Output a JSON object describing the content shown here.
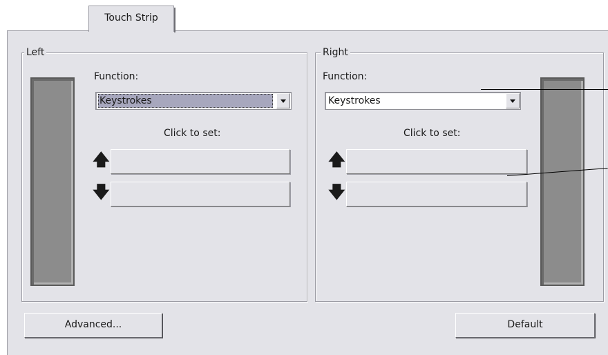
{
  "tab": {
    "label": "Touch Strip"
  },
  "left": {
    "group_label": "Left",
    "function_label": "Function:",
    "function_value": "Keystrokes",
    "click_to_set_label": "Click to set:",
    "up_arrow": "🡅",
    "down_arrow": "🡇"
  },
  "right": {
    "group_label": "Right",
    "function_label": "Function:",
    "function_value": "Keystrokes",
    "click_to_set_label": "Click to set:",
    "up_arrow": "🡅",
    "down_arrow": "🡇"
  },
  "buttons": {
    "advanced": "Advanced...",
    "default": "Default"
  }
}
